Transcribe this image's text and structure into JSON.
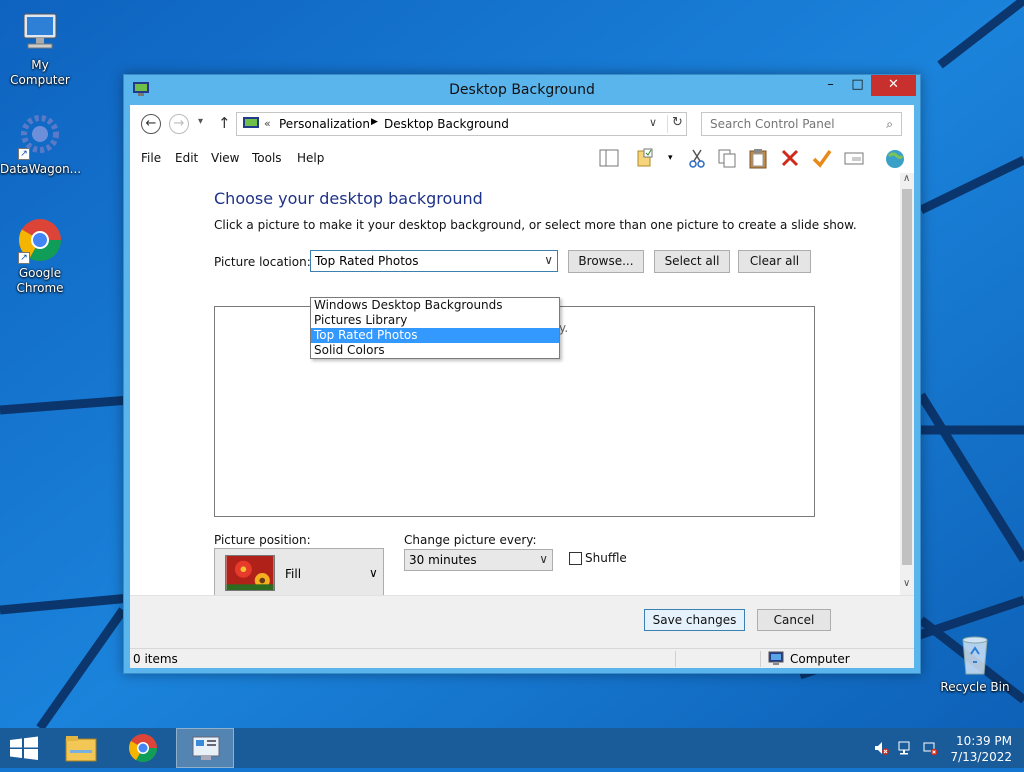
{
  "desktop": {
    "icons": [
      {
        "label": "My Computer"
      },
      {
        "label": "DataWagon..."
      },
      {
        "label": "Google Chrome"
      },
      {
        "label": "Recycle Bin"
      }
    ]
  },
  "window": {
    "title": "Desktop Background",
    "controls": {
      "minimize": "–",
      "maximize": "□",
      "close": "✕"
    }
  },
  "address": {
    "overflow": "«",
    "crumbs": [
      "Personalization",
      "Desktop Background"
    ],
    "search_placeholder": "Search Control Panel"
  },
  "menu": [
    "File",
    "Edit",
    "View",
    "Tools",
    "Help"
  ],
  "page": {
    "title": "Choose your desktop background",
    "subtitle": "Click a picture to make it your desktop background, or select more than one picture to create a slide show.",
    "picture_location_label": "Picture location:",
    "picture_location_value": "Top Rated Photos",
    "browse_label": "Browse...",
    "select_all_label": "Select all",
    "clear_all_label": "Clear all",
    "hint_tail": "y.",
    "dropdown_options": [
      "Windows Desktop Backgrounds",
      "Pictures Library",
      "Top Rated Photos",
      "Solid Colors"
    ],
    "dropdown_selected": "Top Rated Photos",
    "picture_position_label": "Picture position:",
    "picture_position_value": "Fill",
    "change_every_label": "Change picture every:",
    "change_every_value": "30 minutes",
    "shuffle_label": "Shuffle",
    "shuffle_checked": false
  },
  "footer": {
    "save_label": "Save changes",
    "cancel_label": "Cancel"
  },
  "status": {
    "items": "0 items",
    "location": "Computer"
  },
  "taskbar": {
    "time": "10:39 PM",
    "date": "7/13/2022"
  },
  "colors": {
    "accent": "#5ab5ec",
    "title_text": "#1e3287",
    "selection": "#3399ff",
    "close_button": "#c7302d",
    "taskbar": "#1a5b99"
  }
}
